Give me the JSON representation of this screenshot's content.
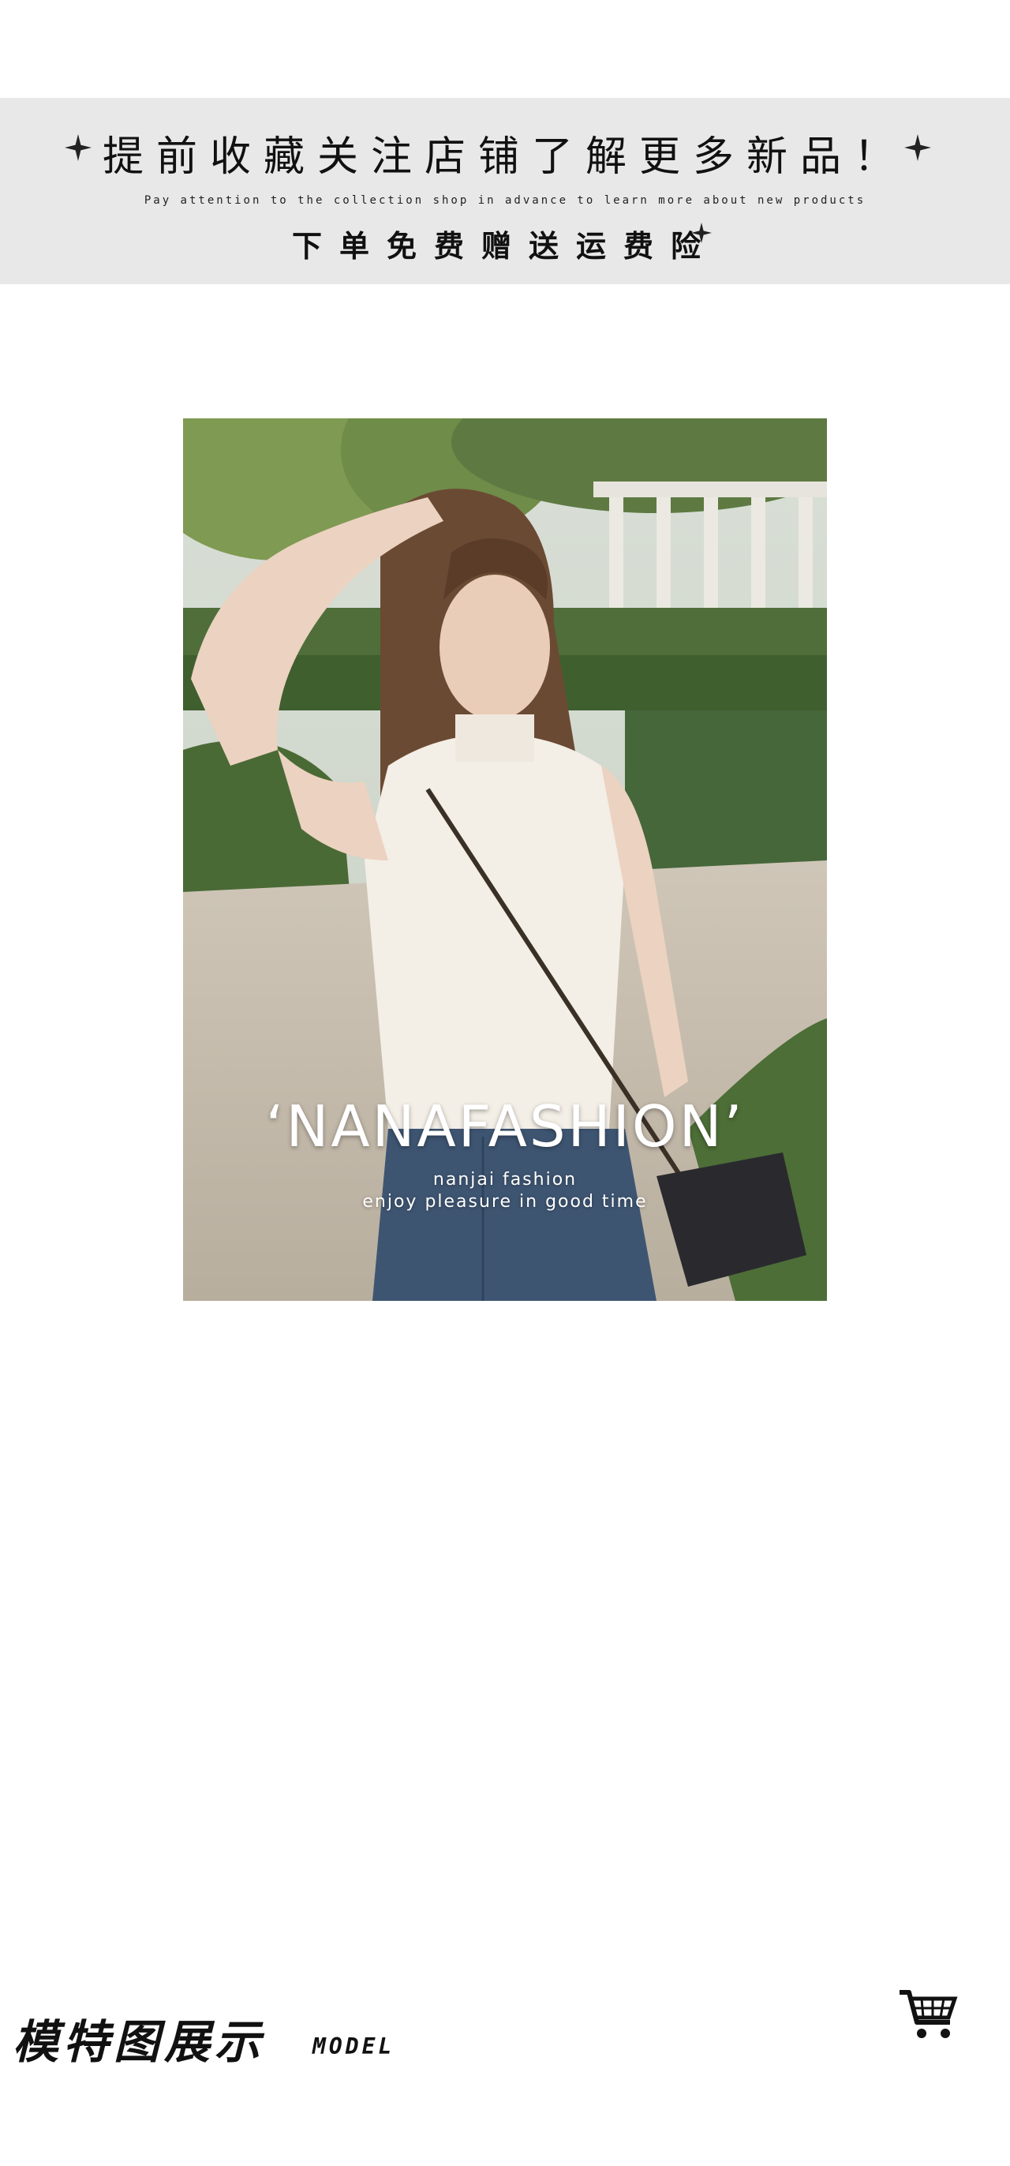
{
  "banner": {
    "title": "提前收藏关注店铺了解更多新品！",
    "subtitle": "Pay attention to the collection shop in advance to learn more about new products",
    "note": "下单免费赠送运费险"
  },
  "photo": {
    "brand": "‘NANAFASHION’",
    "line1": "nanjai fashion",
    "line2": "enjoy pleasure in good time"
  },
  "section": {
    "title": "模特图展示",
    "subtitle": "MODEL"
  },
  "icons": {
    "sparkle": "sparkle-icon",
    "cart": "shopping-cart-icon"
  },
  "colors": {
    "banner_bg": "#e8e8e8",
    "text": "#111111"
  }
}
